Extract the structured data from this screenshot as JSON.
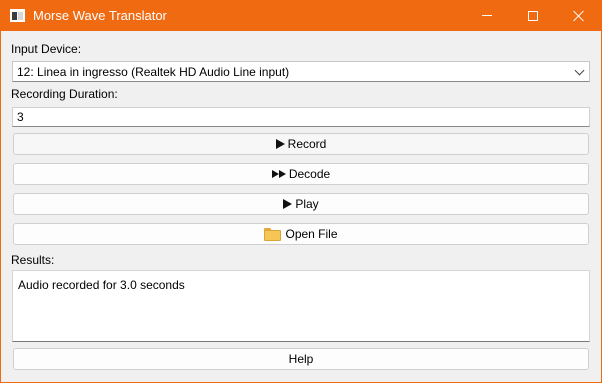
{
  "window": {
    "title": "Morse Wave Translator",
    "controls": {
      "minimize": "minimize",
      "maximize": "maximize",
      "close": "close"
    },
    "accent_color": "#f06a12"
  },
  "form": {
    "input_device_label": "Input Device:",
    "input_device_value": "12: Linea in ingresso (Realtek HD Audio Line input)",
    "duration_label": "Recording Duration:",
    "duration_value": "3"
  },
  "buttons": {
    "record": {
      "label": "Record",
      "icon": "play-icon"
    },
    "decode": {
      "label": "Decode",
      "icon": "fast-forward-icon"
    },
    "play": {
      "label": "Play",
      "icon": "play-icon"
    },
    "open_file": {
      "label": "Open File",
      "icon": "folder-icon"
    },
    "help": {
      "label": "Help"
    }
  },
  "results": {
    "label": "Results:",
    "text": "Audio recorded for 3.0 seconds"
  }
}
